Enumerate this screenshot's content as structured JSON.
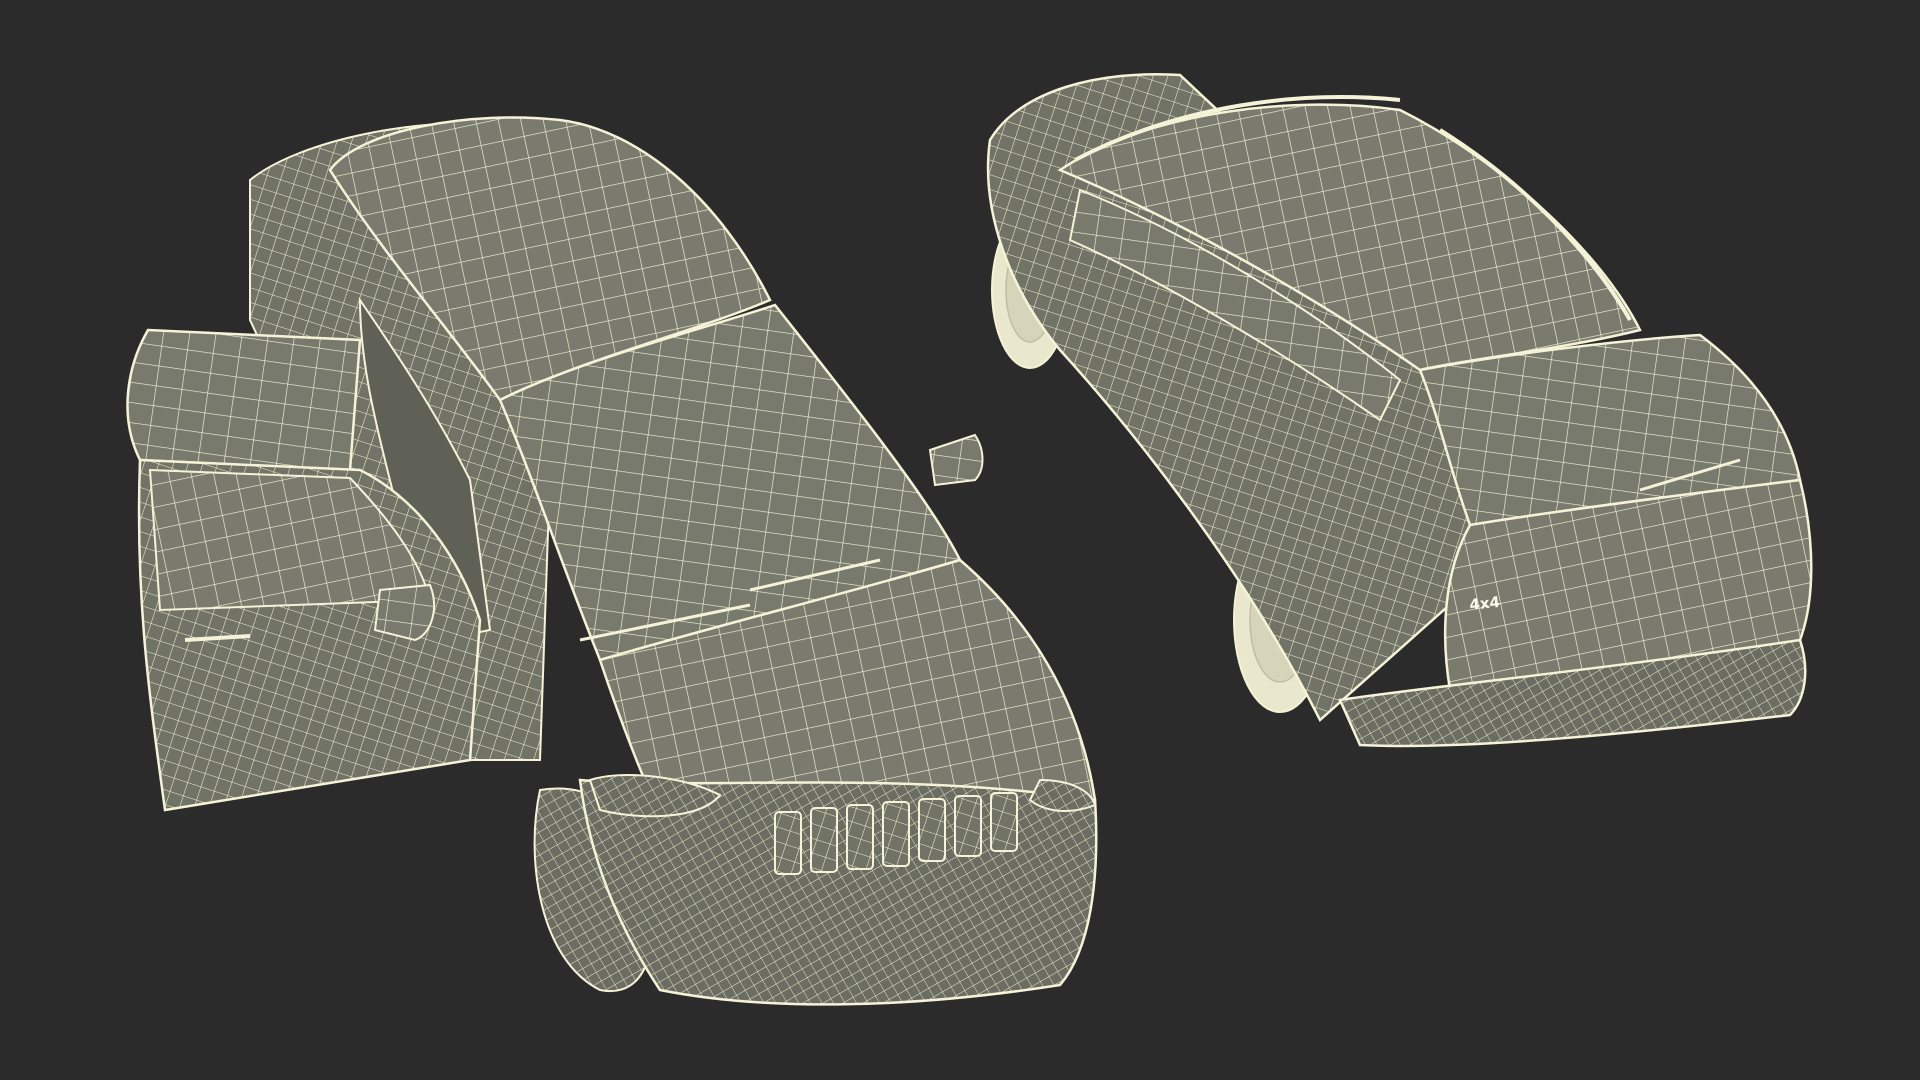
{
  "scene": {
    "background_color": "#2b2b2b",
    "mesh_fill_color": "#7a7b6e",
    "mesh_line_color": "#f4f3d8",
    "shade_color": "#5f6056",
    "objects": [
      {
        "name": "suv-front-three-quarter-doors-open"
      },
      {
        "name": "suv-rear-three-quarter"
      }
    ],
    "rear_badge_text": "4x4"
  }
}
